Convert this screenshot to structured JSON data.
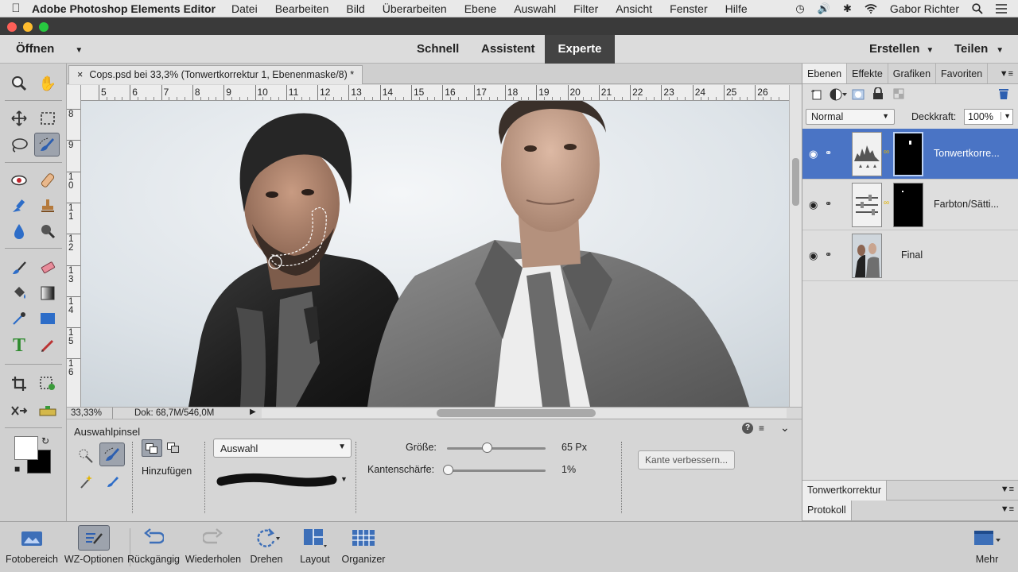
{
  "menubar": {
    "app_name": "Adobe Photoshop Elements Editor",
    "items": [
      "Datei",
      "Bearbeiten",
      "Bild",
      "Überarbeiten",
      "Ebene",
      "Auswahl",
      "Filter",
      "Ansicht",
      "Fenster",
      "Hilfe"
    ],
    "user": "Gabor Richter"
  },
  "modebar": {
    "open_label": "Öffnen",
    "modes": [
      "Schnell",
      "Assistent",
      "Experte"
    ],
    "active_mode": "Experte",
    "create_label": "Erstellen",
    "share_label": "Teilen"
  },
  "document": {
    "tab_title": "Cops.psd bei 33,3% (Tonwertkorrektur 1, Ebenenmaske/8) *",
    "ruler_h": [
      "5",
      "6",
      "7",
      "8",
      "9",
      "10",
      "11",
      "12",
      "13",
      "14",
      "15",
      "16",
      "17",
      "18",
      "19",
      "20",
      "21",
      "22",
      "23",
      "24",
      "25",
      "26"
    ],
    "ruler_v": [
      "8",
      "9",
      "10",
      "11",
      "12",
      "13",
      "14",
      "15",
      "16"
    ],
    "zoom": "33,33%",
    "doc_info": "Dok: 68,7M/546,0M"
  },
  "panels": {
    "tabs": [
      "Ebenen",
      "Effekte",
      "Grafiken",
      "Favoriten"
    ],
    "active_tab": "Ebenen",
    "blend_mode": "Normal",
    "opacity_label": "Deckkraft:",
    "opacity_value": "100%",
    "layers": [
      {
        "name": "Tonwertkorre...",
        "selected": true
      },
      {
        "name": "Farbton/Sätti...",
        "selected": false
      },
      {
        "name": "Final",
        "selected": false
      }
    ],
    "sub_panels": [
      "Tonwertkorrektur",
      "Protokoll"
    ]
  },
  "options": {
    "tool_name": "Auswahlpinsel",
    "mode_label": "Hinzufügen",
    "selection_mode": "Auswahl",
    "size_label": "Größe:",
    "size_value": "65 Px",
    "size_fraction": 0.4,
    "hardness_label": "Kantenschärfe:",
    "hardness_value": "1%",
    "hardness_fraction": 0.01,
    "refine_label": "Kante verbessern..."
  },
  "taskbar": {
    "items": [
      "Fotobereich",
      "WZ-Optionen",
      "Rückgängig",
      "Wiederholen",
      "Drehen",
      "Layout",
      "Organizer"
    ],
    "more_label": "Mehr"
  },
  "colors": {
    "accent": "#4a74c5",
    "active_mode_bg": "#434343"
  }
}
